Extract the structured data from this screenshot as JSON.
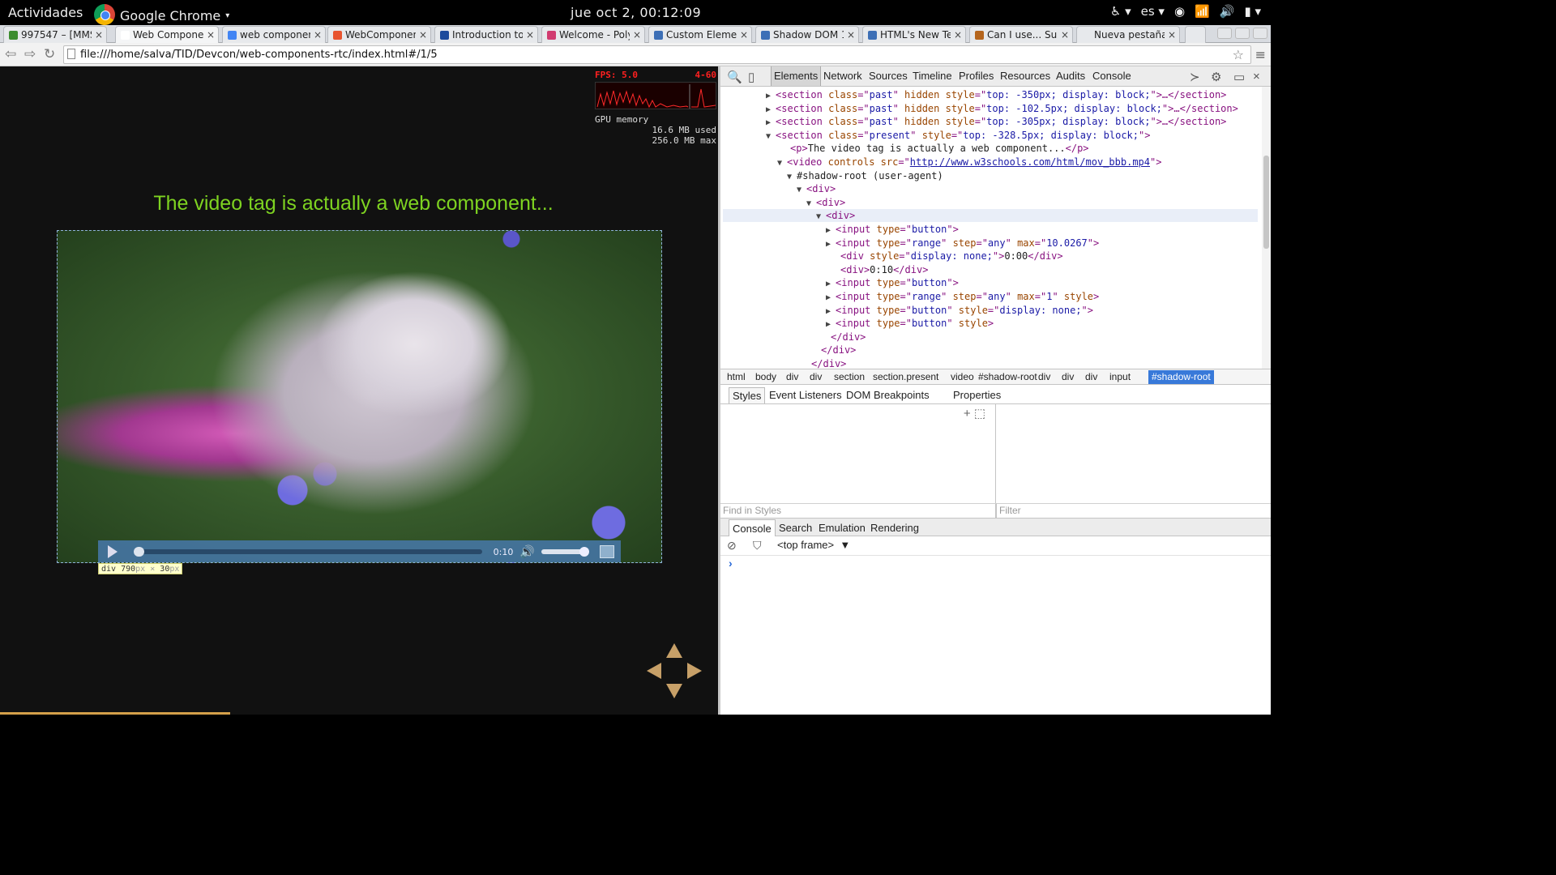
{
  "topbar": {
    "activities": "Actividades",
    "app_name": "Google Chrome",
    "clock": "jue oct  2, 00:12:09",
    "language": "es"
  },
  "tabs": [
    {
      "title": "997547 – [MMS",
      "favicon_color": "#3c8d2f"
    },
    {
      "title": "Web Component",
      "favicon_color": "#ffffff"
    },
    {
      "title": "web components",
      "favicon_color": "#4285f4"
    },
    {
      "title": "WebComponents",
      "favicon_color": "#e8542f"
    },
    {
      "title": "Introduction to W",
      "favicon_color": "#1d4b9c"
    },
    {
      "title": "Welcome - Polym",
      "favicon_color": "#d13b70"
    },
    {
      "title": "Custom Elements",
      "favicon_color": "#3d6fb6"
    },
    {
      "title": "Shadow DOM 10",
      "favicon_color": "#3d6fb6"
    },
    {
      "title": "HTML's New Tem",
      "favicon_color": "#3d6fb6"
    },
    {
      "title": "Can I use... Supp",
      "favicon_color": "#b5651d"
    },
    {
      "title": "Nueva pestaña",
      "favicon_color": ""
    }
  ],
  "address": {
    "url": "file:///home/salva/TID/Devcon/web-components-rtc/index.html#/1/5"
  },
  "fps_meter": {
    "fps_label": "FPS:  5.0",
    "range": "4-60",
    "gpu_label": "GPU memory",
    "used": "16.6 MB used",
    "max": "256.0 MB max"
  },
  "slide": {
    "heading": "The video tag is actually a web component...",
    "video_time": "0:10",
    "video_progress": 0.0,
    "volume": 1.0,
    "tooltip_tag": "div",
    "tooltip_w": "790",
    "tooltip_h": "30",
    "tooltip_unit": "px",
    "tooltip_x": "×",
    "presentation_progress": 0.32
  },
  "devtools": {
    "tabs": [
      "Elements",
      "Network",
      "Sources",
      "Timeline",
      "Profiles",
      "Resources",
      "Audits",
      "Console"
    ],
    "dom_lines": [
      {
        "tri": "▶",
        "parts": [
          [
            "tg",
            "<section "
          ],
          [
            "an",
            "class"
          ],
          [
            "tg",
            "=\""
          ],
          [
            "av",
            "past"
          ],
          [
            "tg",
            "\" "
          ],
          [
            "an",
            "hidden style"
          ],
          [
            "tg",
            "=\""
          ],
          [
            "av",
            "top: -350px; display: block;"
          ],
          [
            "tg",
            "\">…</section>"
          ]
        ]
      },
      {
        "tri": "▶",
        "parts": [
          [
            "tg",
            "<section "
          ],
          [
            "an",
            "class"
          ],
          [
            "tg",
            "=\""
          ],
          [
            "av",
            "past"
          ],
          [
            "tg",
            "\" "
          ],
          [
            "an",
            "hidden style"
          ],
          [
            "tg",
            "=\""
          ],
          [
            "av",
            "top: -102.5px; display: block;"
          ],
          [
            "tg",
            "\">…</section>"
          ]
        ]
      },
      {
        "tri": "▶",
        "parts": [
          [
            "tg",
            "<section "
          ],
          [
            "an",
            "class"
          ],
          [
            "tg",
            "=\""
          ],
          [
            "av",
            "past"
          ],
          [
            "tg",
            "\" "
          ],
          [
            "an",
            "hidden style"
          ],
          [
            "tg",
            "=\""
          ],
          [
            "av",
            "top: -305px; display: block;"
          ],
          [
            "tg",
            "\">…</section>"
          ]
        ]
      },
      {
        "tri": "▼",
        "parts": [
          [
            "tg",
            "<section "
          ],
          [
            "an",
            "class"
          ],
          [
            "tg",
            "=\""
          ],
          [
            "av",
            "present"
          ],
          [
            "tg",
            "\" "
          ],
          [
            "an",
            "style"
          ],
          [
            "tg",
            "=\""
          ],
          [
            "av",
            "top: -328.5px; display: block;"
          ],
          [
            "tg",
            "\">"
          ]
        ]
      },
      {
        "tri": "",
        "parts": [
          [
            "tg",
            "<p>"
          ],
          [
            "tx",
            "The video tag is actually a web component..."
          ],
          [
            "tg",
            "</p>"
          ]
        ]
      },
      {
        "tri": "▼",
        "parts": [
          [
            "tg",
            "<video "
          ],
          [
            "an",
            "controls src"
          ],
          [
            "tg",
            "=\""
          ],
          [
            "lk",
            "http://www.w3schools.com/html/mov_bbb.mp4"
          ],
          [
            "tg",
            "\">"
          ]
        ]
      },
      {
        "tri": "▼",
        "parts": [
          [
            "tx",
            "#shadow-root (user-agent)"
          ]
        ]
      },
      {
        "tri": "▼",
        "parts": [
          [
            "tg",
            "<div>"
          ]
        ]
      },
      {
        "tri": "▼",
        "parts": [
          [
            "tg",
            "<div>"
          ]
        ]
      },
      {
        "tri": "▼",
        "parts": [
          [
            "tg",
            "<div>"
          ]
        ]
      },
      {
        "tri": "▶",
        "parts": [
          [
            "tg",
            "<input "
          ],
          [
            "an",
            "type"
          ],
          [
            "tg",
            "=\""
          ],
          [
            "av",
            "button"
          ],
          [
            "tg",
            "\">"
          ]
        ]
      },
      {
        "tri": "▶",
        "parts": [
          [
            "tg",
            "<input "
          ],
          [
            "an",
            "type"
          ],
          [
            "tg",
            "=\""
          ],
          [
            "av",
            "range"
          ],
          [
            "tg",
            "\" "
          ],
          [
            "an",
            "step"
          ],
          [
            "tg",
            "=\""
          ],
          [
            "av",
            "any"
          ],
          [
            "tg",
            "\" "
          ],
          [
            "an",
            "max"
          ],
          [
            "tg",
            "=\""
          ],
          [
            "av",
            "10.0267"
          ],
          [
            "tg",
            "\">"
          ]
        ]
      },
      {
        "tri": "",
        "parts": [
          [
            "tg",
            "<div "
          ],
          [
            "an",
            "style"
          ],
          [
            "tg",
            "=\""
          ],
          [
            "av",
            "display: none;"
          ],
          [
            "tg",
            "\">"
          ],
          [
            "tx",
            "0:00"
          ],
          [
            "tg",
            "</div>"
          ]
        ]
      },
      {
        "tri": "",
        "parts": [
          [
            "tg",
            "<div>"
          ],
          [
            "tx",
            "0:10"
          ],
          [
            "tg",
            "</div>"
          ]
        ]
      },
      {
        "tri": "▶",
        "parts": [
          [
            "tg",
            "<input "
          ],
          [
            "an",
            "type"
          ],
          [
            "tg",
            "=\""
          ],
          [
            "av",
            "button"
          ],
          [
            "tg",
            "\">"
          ]
        ]
      },
      {
        "tri": "▶",
        "parts": [
          [
            "tg",
            "<input "
          ],
          [
            "an",
            "type"
          ],
          [
            "tg",
            "=\""
          ],
          [
            "av",
            "range"
          ],
          [
            "tg",
            "\" "
          ],
          [
            "an",
            "step"
          ],
          [
            "tg",
            "=\""
          ],
          [
            "av",
            "any"
          ],
          [
            "tg",
            "\" "
          ],
          [
            "an",
            "max"
          ],
          [
            "tg",
            "=\""
          ],
          [
            "av",
            "1"
          ],
          [
            "tg",
            "\" "
          ],
          [
            "an",
            "style"
          ],
          [
            "tg",
            ">"
          ]
        ]
      },
      {
        "tri": "▶",
        "parts": [
          [
            "tg",
            "<input "
          ],
          [
            "an",
            "type"
          ],
          [
            "tg",
            "=\""
          ],
          [
            "av",
            "button"
          ],
          [
            "tg",
            "\" "
          ],
          [
            "an",
            "style"
          ],
          [
            "tg",
            "=\""
          ],
          [
            "av",
            "display: none;"
          ],
          [
            "tg",
            "\">"
          ]
        ]
      },
      {
        "tri": "▶",
        "parts": [
          [
            "tg",
            "<input "
          ],
          [
            "an",
            "type"
          ],
          [
            "tg",
            "=\""
          ],
          [
            "av",
            "button"
          ],
          [
            "tg",
            "\" "
          ],
          [
            "an",
            "style"
          ],
          [
            "tg",
            ">"
          ]
        ]
      },
      {
        "tri": "",
        "parts": [
          [
            "tg",
            "</div>"
          ]
        ]
      },
      {
        "tri": "",
        "parts": [
          [
            "tg",
            "</div>"
          ]
        ]
      },
      {
        "tri": "",
        "parts": [
          [
            "tg",
            "</div>"
          ]
        ]
      }
    ],
    "breadcrumbs": [
      "html",
      "body",
      "div",
      "div",
      "section",
      "section.present",
      "video",
      "#shadow-root",
      "div",
      "div",
      "div",
      "input",
      "#shadow-root"
    ],
    "sidebar_tabs": [
      "Styles",
      "Event Listeners",
      "DOM Breakpoints",
      "Properties"
    ],
    "find_placeholder": "Find in Styles",
    "filter_placeholder": "Filter",
    "drawer_tabs": [
      "Console",
      "Search",
      "Emulation",
      "Rendering"
    ],
    "frame_selector": "<top frame>",
    "prompt": "›"
  }
}
